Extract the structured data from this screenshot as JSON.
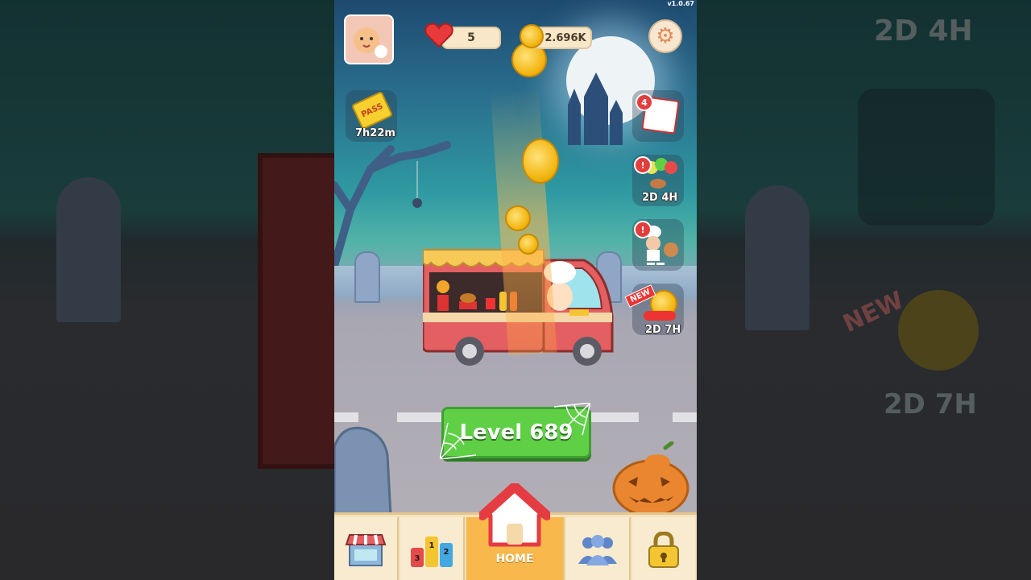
{
  "version": "v1.0.67",
  "hud": {
    "lives": "5",
    "coins": "2.696K"
  },
  "side_panel": {
    "pass_label": "PASS",
    "pass_timer": "7h22m",
    "calendar_badge": "4",
    "balloon_timer": "2D 4H",
    "new_tag": "NEW",
    "gift_timer": "2D 7H",
    "alert_symbol": "!"
  },
  "level_button": "Level 689",
  "nav": {
    "home_label": "HOME",
    "ranks": [
      "3",
      "1",
      "2"
    ]
  },
  "background": {
    "top_timer": "2D 4H",
    "bottom_timer": "2D 7H",
    "new_tag": "NEW"
  },
  "colors": {
    "level_button": "#5fd046",
    "home_tab": "#f8b84c",
    "heart": "#e83a3a"
  }
}
